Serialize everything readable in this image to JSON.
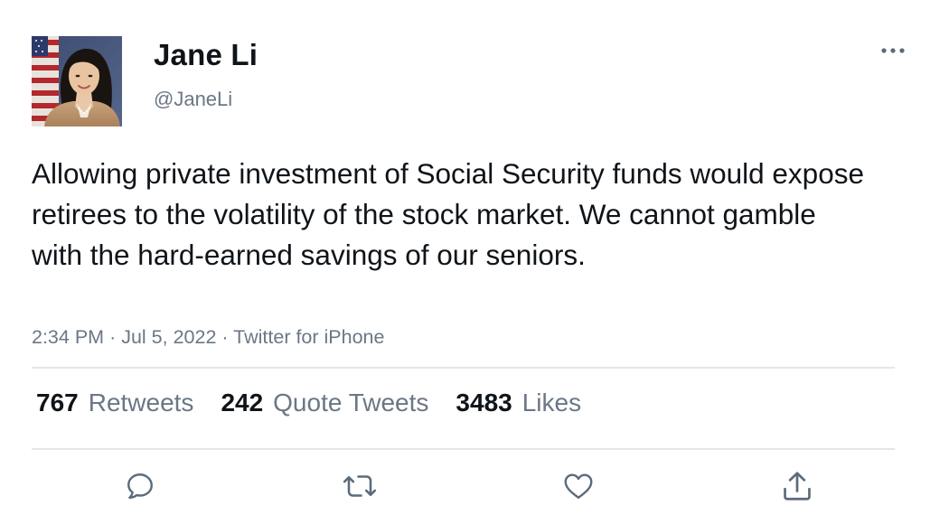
{
  "author": {
    "display_name": "Jane Li",
    "handle": "@JaneLi",
    "avatar": "profile-photo"
  },
  "tweet": {
    "text": "Allowing private investment of Social Security funds would expose retirees to the volatility of the stock market. We cannot gamble with the hard-earned savings of our seniors.",
    "time": "2:34 PM",
    "separator": "·",
    "date": "Jul 5, 2022",
    "source": "Twitter for iPhone"
  },
  "stats": {
    "retweets": {
      "count": "767",
      "label": "Retweets"
    },
    "quote_tweets": {
      "count": "242",
      "label": "Quote Tweets"
    },
    "likes": {
      "count": "3483",
      "label": "Likes"
    }
  },
  "actions": [
    "reply-icon",
    "retweet-icon",
    "like-icon",
    "share-icon"
  ],
  "colors": {
    "text_primary": "#0f1419",
    "text_secondary": "#6b7785",
    "divider": "#e3e6e8",
    "icon": "#5b6b7a"
  }
}
